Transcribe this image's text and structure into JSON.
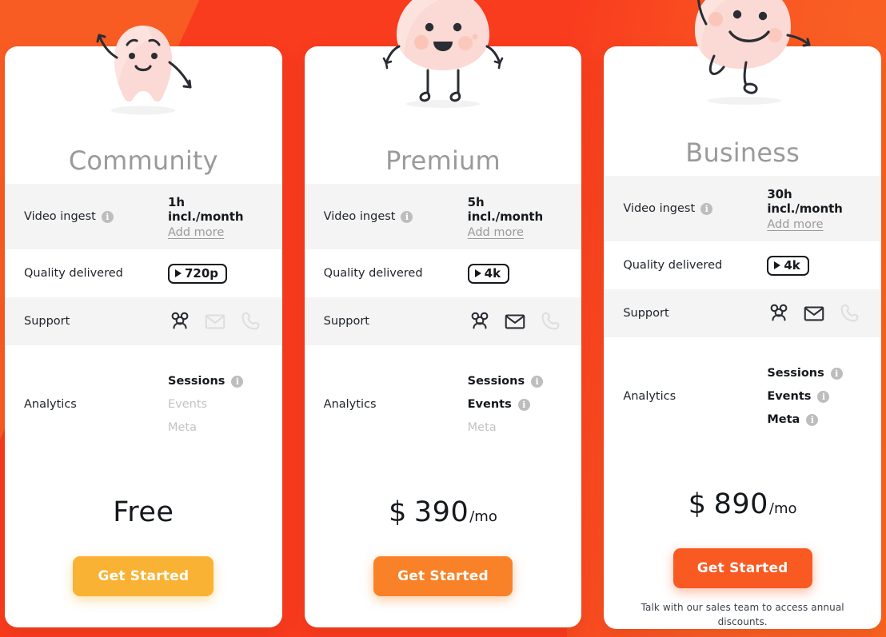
{
  "background": {
    "left_color": "#f95c23",
    "slash_color": "#f93b1e",
    "right_color": "#fa6321"
  },
  "labels": {
    "video_ingest": "Video ingest",
    "quality_delivered": "Quality delivered",
    "support": "Support",
    "analytics": "Analytics",
    "add_more": "Add more",
    "info_glyph": "i"
  },
  "plans": [
    {
      "name": "Community",
      "mascot": "waving-blob-mascot",
      "ingest": "1h incl./month",
      "add_more": "Add more",
      "quality": "720p",
      "support": [
        {
          "icon": "community-icon",
          "enabled": true
        },
        {
          "icon": "email-icon",
          "enabled": false
        },
        {
          "icon": "phone-icon",
          "enabled": false
        }
      ],
      "analytics": [
        {
          "label": "Sessions",
          "enabled": true
        },
        {
          "label": "Events",
          "enabled": false
        },
        {
          "label": "Meta",
          "enabled": false
        }
      ],
      "price": {
        "currency": "",
        "amount": "Free",
        "period": ""
      },
      "cta": "Get Started",
      "cta_color": "#f9b233",
      "note": ""
    },
    {
      "name": "Premium",
      "mascot": "standing-blob-mascot",
      "ingest": "5h incl./month",
      "add_more": "Add more",
      "quality": "4k",
      "support": [
        {
          "icon": "community-icon",
          "enabled": true
        },
        {
          "icon": "email-icon",
          "enabled": true
        },
        {
          "icon": "phone-icon",
          "enabled": false
        }
      ],
      "analytics": [
        {
          "label": "Sessions",
          "enabled": true
        },
        {
          "label": "Events",
          "enabled": true
        },
        {
          "label": "Meta",
          "enabled": false
        }
      ],
      "price": {
        "currency": "$",
        "amount": "390",
        "period": "/mo"
      },
      "cta": "Get Started",
      "cta_color": "#f98128",
      "note": ""
    },
    {
      "name": "Business",
      "mascot": "jumping-blob-mascot",
      "ingest": "30h incl./month",
      "add_more": "Add more",
      "quality": "4k",
      "support": [
        {
          "icon": "community-icon",
          "enabled": true
        },
        {
          "icon": "email-icon",
          "enabled": true
        },
        {
          "icon": "phone-icon",
          "enabled": false
        }
      ],
      "analytics": [
        {
          "label": "Sessions",
          "enabled": true
        },
        {
          "label": "Events",
          "enabled": true
        },
        {
          "label": "Meta",
          "enabled": true
        }
      ],
      "price": {
        "currency": "$",
        "amount": "890",
        "period": "/mo"
      },
      "cta": "Get Started",
      "cta_color": "#f95a22",
      "note": "Talk with our sales team to access annual discounts."
    }
  ]
}
